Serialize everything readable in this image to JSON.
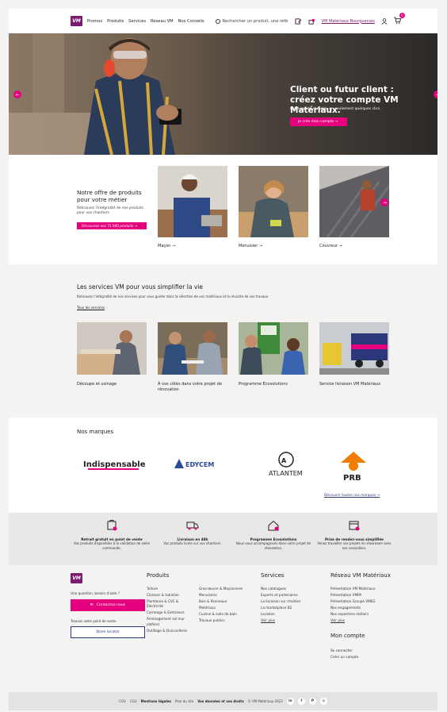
{
  "header": {
    "logo": "VM",
    "nav": [
      "Promos",
      "Produits",
      "Services",
      "Réseau VM",
      "Nos Conseils"
    ],
    "search_placeholder": "Rechercher un produit, une réfé",
    "store_link": "VM Matériaux Bourguenais",
    "cart_count": "0"
  },
  "hero": {
    "title": "Client ou futur client : créez votre compte VM Matériaux.",
    "subtitle": "C'est rapide et facile, en seulement quelques clics.",
    "cta": "Je crée mon compte  →",
    "prev": "←",
    "next": "→"
  },
  "offer": {
    "title": "Notre offre de produits pour votre métier",
    "text": "Retrouvez l'intégralité de nos produits pour vos chantiers",
    "cta": "Découvrez nos 75 000 produits  →",
    "cards": [
      {
        "label": "Maçon  →"
      },
      {
        "label": "Menuisier  →"
      },
      {
        "label": "Couvreur  →"
      }
    ]
  },
  "services": {
    "title": "Les services VM pour vous simplifier la vie",
    "desc": "Retrouvez l'intégralité de nos services pour vous guider dans la sélection de vos matériaux et la réussite de vos travaux",
    "all": "Tous les services",
    "cards": [
      {
        "label": "Découpe et usinage"
      },
      {
        "label": "À vos côtés dans votre projet de rénovation"
      },
      {
        "label": "Programme Ecosolutions"
      },
      {
        "label": "Service livraison VM Matériaux"
      }
    ]
  },
  "brands": {
    "title": "Nos marques",
    "items": [
      "Indispensables",
      "EDYCEM",
      "ATLANTEM",
      "PRB"
    ],
    "more": "Découvrir toutes nos marques  →"
  },
  "features": [
    {
      "title": "Retrait gratuit en point de vente",
      "desc": "Vos produits disponibles à la validation de votre commande."
    },
    {
      "title": "Livraison en 48h",
      "desc": "Vos produits livrés sur vos chantiers."
    },
    {
      "title": "Programme Ecosolutions",
      "desc": "Nous vous accompagnons dans votre projet de rénovation."
    },
    {
      "title": "Prise de rendez-vous simplifiée",
      "desc": "Venez travailler vos projets en showroom avec nos conseillers."
    }
  ],
  "footer": {
    "question": "Une question, besoin d'aide ?",
    "contact": "Contactez-nous",
    "store_q": "Trouvez votre point de vente",
    "store_btn": "Store locator",
    "produits_title": "Produits",
    "produits_col1": [
      "Toiture",
      "Cloisons & Isolation",
      "Plomberie & CVC & Électricité",
      "Carrelage & Extérieurs",
      "Aménagement sol mur plafond",
      "Outillage & Quincaillerie"
    ],
    "produits_col2": [
      "Gros-œuvre & Maçonnerie",
      "Menuiserie",
      "Bois & Panneaux",
      "Matériaux",
      "Cuisine & salle de bain",
      "Travaux publics"
    ],
    "services_title": "Services",
    "services_links": [
      "Nos catalogues",
      "Experts et partenaires",
      "La livraison sur chantier",
      "La marketplace B2",
      "Location",
      "Voir plus"
    ],
    "reseau_title": "Réseau VM Matériaux",
    "reseau_links": [
      "Présentation VM Matériaux",
      "Présentation VMPA",
      "Présentation Groupe VMEG",
      "Nos engagements",
      "Nos expertises métiers",
      "Voir plus"
    ],
    "compte_title": "Mon compte",
    "compte_links": [
      "Se connecter",
      "Créer un compte"
    ]
  },
  "bottom": {
    "links": [
      "CGV",
      "CGU",
      "Mentions légales",
      "Plan du site",
      "Vos données et vos droits",
      "© VM Matériaux 2023"
    ],
    "social": [
      "in",
      "f",
      "P",
      "◎"
    ]
  }
}
